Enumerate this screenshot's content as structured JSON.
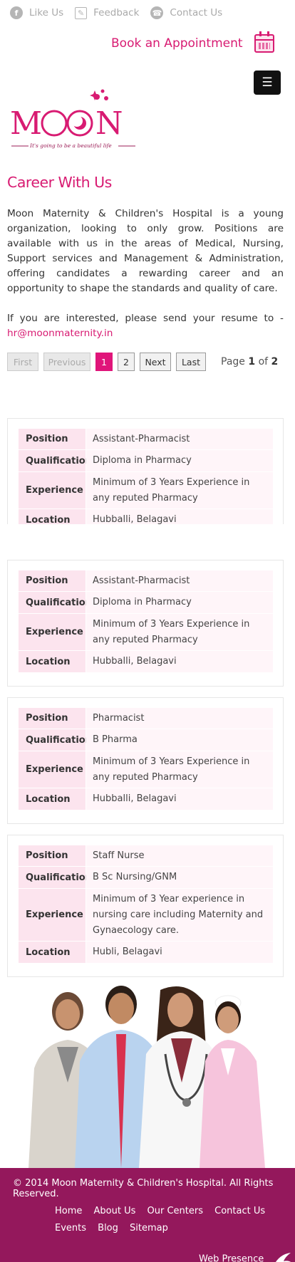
{
  "topbar": {
    "like": "Like Us",
    "feedback": "Feedback",
    "contact": "Contact Us"
  },
  "book_label": "Book an Appointment",
  "logo": {
    "name": "MOON",
    "tagline": "It's going to be a beautiful life"
  },
  "title": "Career With Us",
  "intro": "Moon Maternity & Children's Hospital is a young organization, looking to only grow. Positions are available with us in the areas of Medical, Nursing, Support services and Management & Administration, offering candidates a rewarding career and an opportunity to shape the standards and quality of care.",
  "resume_text": "If you are interested, please send your resume to -",
  "email": "hr@moonmaternity.in",
  "pager": {
    "first": "First",
    "previous": "Previous",
    "p1": "1",
    "p2": "2",
    "next": "Next",
    "last": "Last",
    "page_word": "Page",
    "current": "1",
    "of_word": "of",
    "total": "2"
  },
  "labels": {
    "position": "Position",
    "qualification": "Qualification",
    "experience": "Experience",
    "location": "Location"
  },
  "jobs": [
    {
      "position": "Assistant-Pharmacist",
      "qualification": "Diploma in Pharmacy",
      "experience": "Minimum of 3 Years Experience in any reputed Pharmacy",
      "location": "Hubballi, Belagavi"
    },
    {
      "position": "Assistant-Pharmacist",
      "qualification": "Diploma in Pharmacy",
      "experience": "Minimum of 3 Years Experience in any reputed Pharmacy",
      "location": "Hubballi, Belagavi"
    },
    {
      "position": "Pharmacist",
      "qualification": "B Pharma",
      "experience": "Minimum of 3 Years Experience in any reputed Pharmacy",
      "location": "Hubballi, Belagavi"
    },
    {
      "position": "Staff Nurse",
      "qualification": "B Sc Nursing/GNM",
      "experience": "Minimum of 3 Year experience in nursing care including Maternity and Gynaecology care.",
      "location": "Hubli, Belagavi"
    }
  ],
  "footer": {
    "copyright": "© 2014 Moon Maternity & Children's Hospital. All Rights Reserved.",
    "links": [
      "Home",
      "About Us",
      "Our Centers",
      "Contact Us",
      "Events",
      "Blog",
      "Sitemap"
    ],
    "web_presence": "Web Presence"
  },
  "colors": {
    "brand": "#d81b72",
    "footer": "#94185c",
    "label_bg": "#fce4ee"
  }
}
